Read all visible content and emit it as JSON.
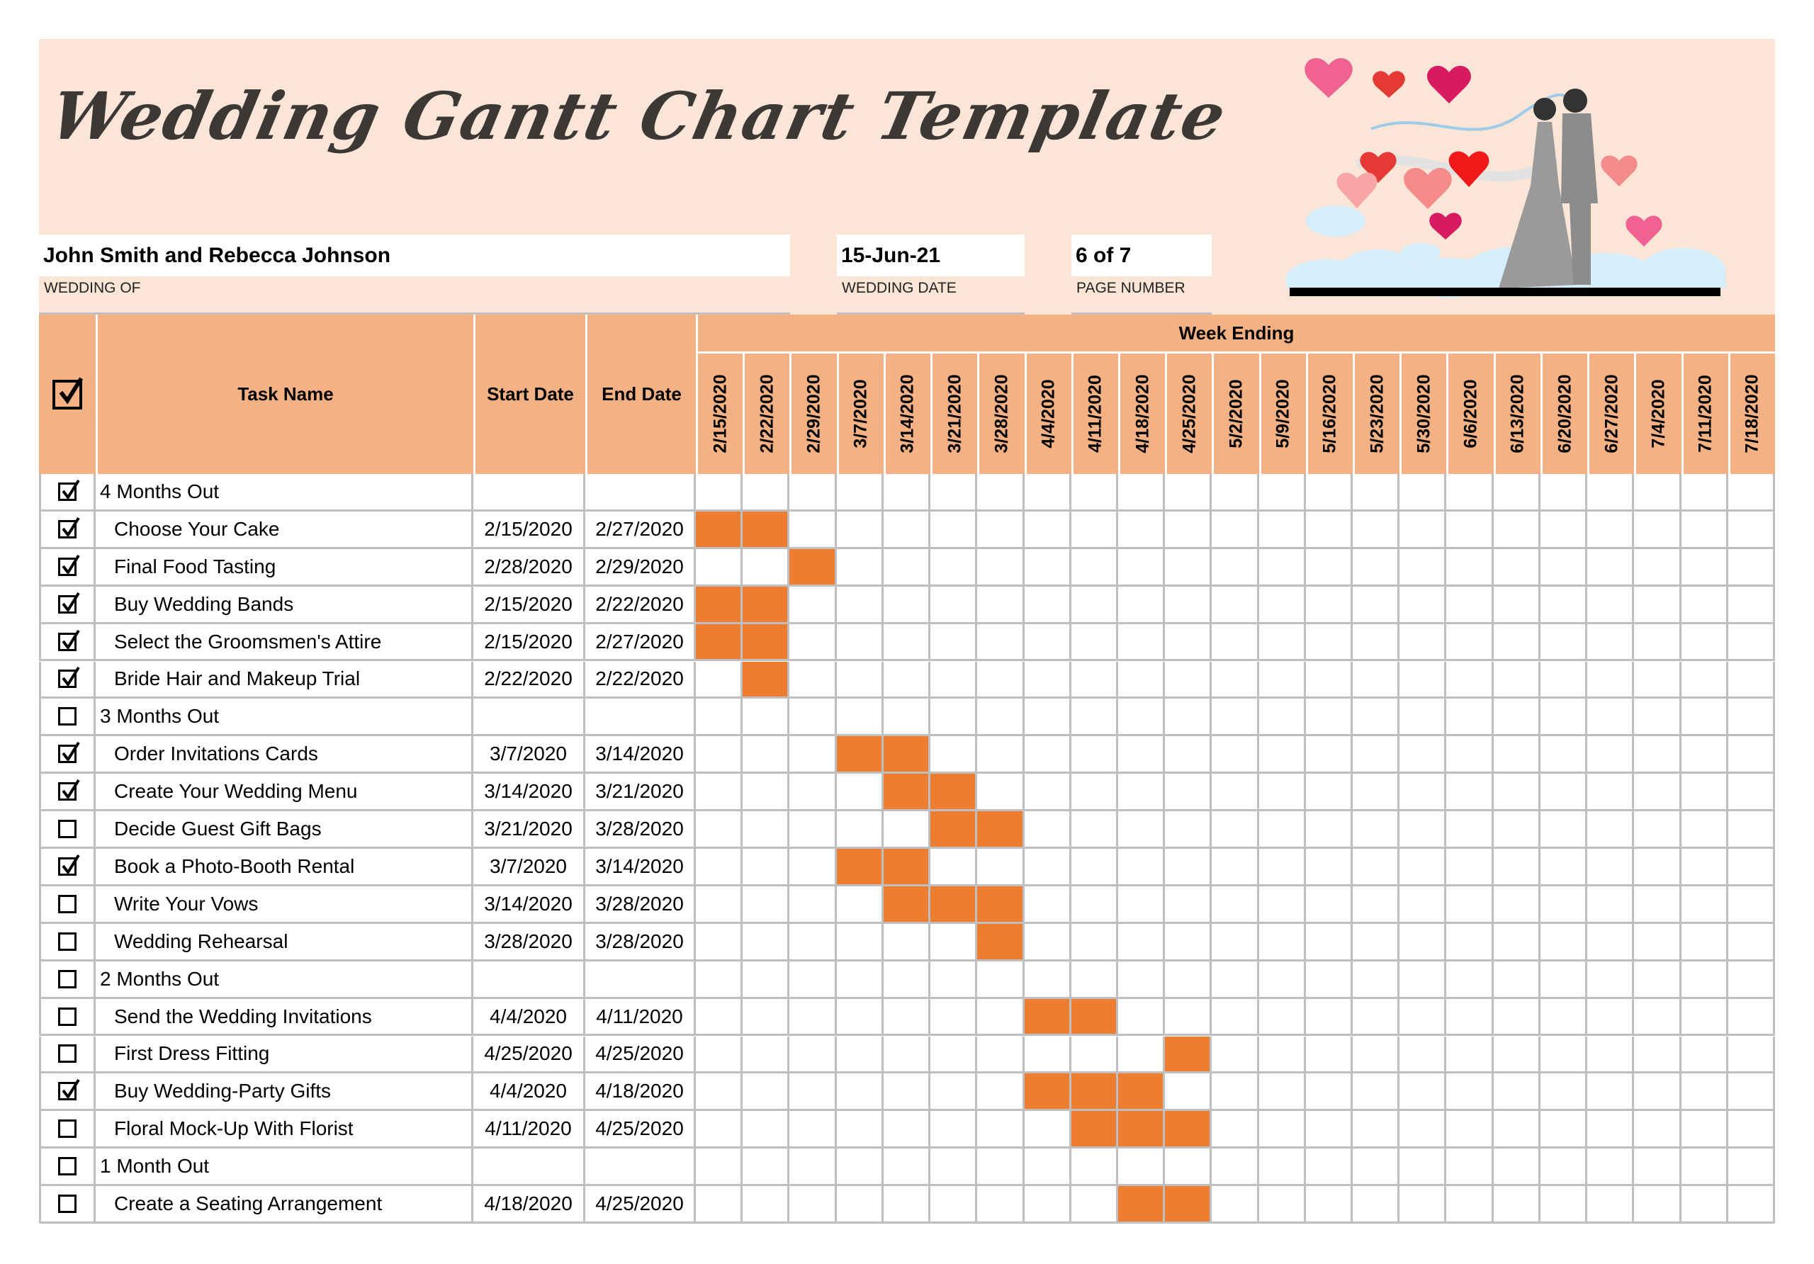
{
  "title": "Wedding Gantt Chart Template",
  "info": {
    "wedding_of_value": "John Smith and Rebecca Johnson",
    "wedding_of_label": "WEDDING OF",
    "wedding_date_value": "15-Jun-21",
    "wedding_date_label": "WEDDING DATE",
    "page_number_value": "6 of 7",
    "page_number_label": "PAGE NUMBER"
  },
  "illustration": "wedding-couple-with-heart-balloons",
  "colors": {
    "banner_bg": "#FBE5D6",
    "header_bg": "#F4B183",
    "bar": "#ED7D31",
    "grid": "#BFBFBF"
  },
  "table": {
    "headers": {
      "check_icon": "checked-box-icon",
      "task_name": "Task Name",
      "start_date": "Start Date",
      "end_date": "End Date",
      "week_ending": "Week Ending"
    },
    "weeks": [
      "2/15/2020",
      "2/22/2020",
      "2/29/2020",
      "3/7/2020",
      "3/14/2020",
      "3/21/2020",
      "3/28/2020",
      "4/4/2020",
      "4/11/2020",
      "4/18/2020",
      "4/25/2020",
      "5/2/2020",
      "5/9/2020",
      "5/16/2020",
      "5/23/2020",
      "5/30/2020",
      "6/6/2020",
      "6/13/2020",
      "6/20/2020",
      "6/27/2020",
      "7/4/2020",
      "7/11/2020",
      "7/18/2020"
    ],
    "rows": [
      {
        "type": "group",
        "checked": true,
        "task": "4 Months Out",
        "start": "",
        "end": "",
        "weeks": []
      },
      {
        "type": "task",
        "checked": true,
        "task": "Choose Your Cake",
        "start": "2/15/2020",
        "end": "2/27/2020",
        "weeks": [
          0,
          1
        ]
      },
      {
        "type": "task",
        "checked": true,
        "task": "Final Food Tasting",
        "start": "2/28/2020",
        "end": "2/29/2020",
        "weeks": [
          2
        ]
      },
      {
        "type": "task",
        "checked": true,
        "task": "Buy Wedding Bands",
        "start": "2/15/2020",
        "end": "2/22/2020",
        "weeks": [
          0,
          1
        ]
      },
      {
        "type": "task",
        "checked": true,
        "task": "Select the Groomsmen's Attire",
        "start": "2/15/2020",
        "end": "2/27/2020",
        "weeks": [
          0,
          1
        ]
      },
      {
        "type": "task",
        "checked": true,
        "task": "Bride Hair and Makeup Trial",
        "start": "2/22/2020",
        "end": "2/22/2020",
        "weeks": [
          1
        ]
      },
      {
        "type": "group",
        "checked": false,
        "task": "3 Months Out",
        "start": "",
        "end": "",
        "weeks": []
      },
      {
        "type": "task",
        "checked": true,
        "task": "Order Invitations Cards",
        "start": "3/7/2020",
        "end": "3/14/2020",
        "weeks": [
          3,
          4
        ]
      },
      {
        "type": "task",
        "checked": true,
        "task": "Create Your Wedding Menu",
        "start": "3/14/2020",
        "end": "3/21/2020",
        "weeks": [
          4,
          5
        ]
      },
      {
        "type": "task",
        "checked": false,
        "task": "Decide Guest Gift Bags",
        "start": "3/21/2020",
        "end": "3/28/2020",
        "weeks": [
          5,
          6
        ]
      },
      {
        "type": "task",
        "checked": true,
        "task": "Book a Photo-Booth Rental",
        "start": "3/7/2020",
        "end": "3/14/2020",
        "weeks": [
          3,
          4
        ]
      },
      {
        "type": "task",
        "checked": false,
        "task": "Write Your Vows",
        "start": "3/14/2020",
        "end": "3/28/2020",
        "weeks": [
          4,
          5,
          6
        ]
      },
      {
        "type": "task",
        "checked": false,
        "task": "Wedding Rehearsal",
        "start": "3/28/2020",
        "end": "3/28/2020",
        "weeks": [
          6
        ]
      },
      {
        "type": "group",
        "checked": false,
        "task": "2 Months Out",
        "start": "",
        "end": "",
        "weeks": []
      },
      {
        "type": "task",
        "checked": false,
        "task": "Send the Wedding Invitations",
        "start": "4/4/2020",
        "end": "4/11/2020",
        "weeks": [
          7,
          8
        ]
      },
      {
        "type": "task",
        "checked": false,
        "task": "First Dress Fitting",
        "start": "4/25/2020",
        "end": "4/25/2020",
        "weeks": [
          10
        ]
      },
      {
        "type": "task",
        "checked": true,
        "task": "Buy Wedding-Party Gifts",
        "start": "4/4/2020",
        "end": "4/18/2020",
        "weeks": [
          7,
          8,
          9
        ]
      },
      {
        "type": "task",
        "checked": false,
        "task": "Floral Mock-Up With Florist",
        "start": "4/11/2020",
        "end": "4/25/2020",
        "weeks": [
          8,
          9,
          10
        ]
      },
      {
        "type": "group",
        "checked": false,
        "task": "1 Month Out",
        "start": "",
        "end": "",
        "weeks": []
      },
      {
        "type": "task",
        "checked": false,
        "task": "Create a Seating Arrangement",
        "start": "4/18/2020",
        "end": "4/25/2020",
        "weeks": [
          9,
          10
        ]
      }
    ]
  }
}
